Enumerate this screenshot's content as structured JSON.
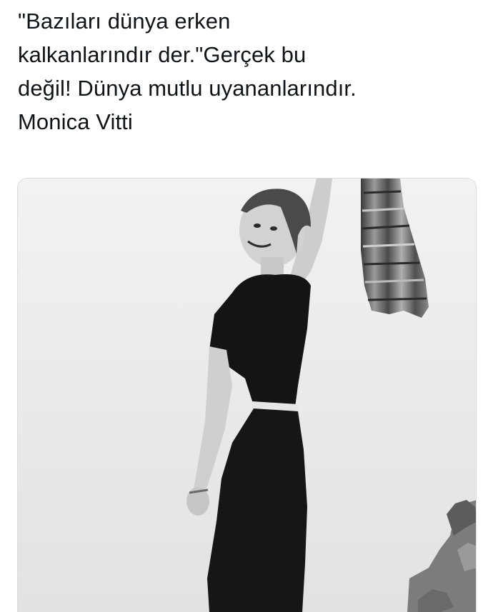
{
  "tweet": {
    "lines": [
      "\"Bazıları dünya erken",
      "kalkanlarındır der.\"Gerçek bu",
      "değil! Dünya mutlu uyananlarındır.",
      "Monica Vitti"
    ]
  },
  "media": {
    "photo_alt_icon": "photo-icon",
    "palette": {
      "sky": "#eeeeee",
      "clothing": "#141414",
      "skin": "#cfcfcf",
      "hair": "#4a4a4a",
      "rock": "#8a8a8a"
    }
  }
}
